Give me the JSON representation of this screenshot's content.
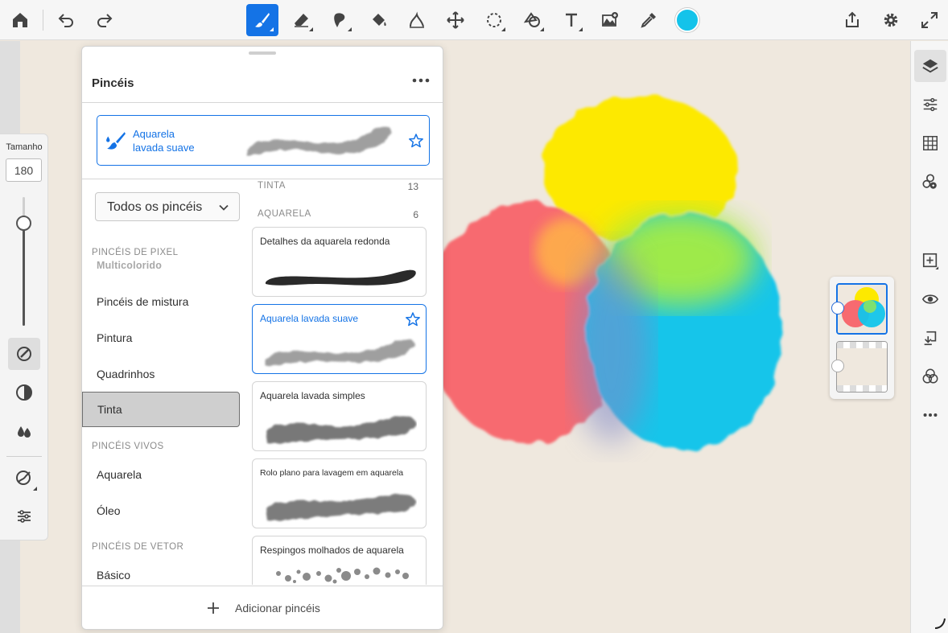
{
  "toolbar": {
    "tools": [
      "home-icon",
      "undo-icon",
      "redo-icon",
      "brush-icon",
      "eraser-icon",
      "smudge-icon",
      "fill-icon",
      "liquify-icon",
      "transform-icon",
      "lasso-selection-icon",
      "shape-icon",
      "text-icon",
      "image-add-icon",
      "eyedropper-icon",
      "share-icon",
      "settings-icon",
      "fullscreen-icon"
    ],
    "active_tool": "brush-icon",
    "current_color": "#14c3ea",
    "accent": "#1473e6"
  },
  "left_panel": {
    "size_label": "Tamanho",
    "size_value": "180",
    "size_level": 0.8
  },
  "brushes": {
    "title": "Pincéis",
    "current": {
      "line1": "Aquarela",
      "line2": "lavada suave"
    },
    "filter": "Todos os pincéis",
    "categories": {
      "pixel_header": "PINCÉIS DE PIXEL",
      "pixel_sub": "Multicolorido",
      "mix": "Pincéis de mistura",
      "paint": "Pintura",
      "comics": "Quadrinhos",
      "ink": "Tinta",
      "live_header": "PINCÉIS VIVOS",
      "watercolor": "Aquarela",
      "oil": "Óleo",
      "vector_header": "PINCÉIS DE VETOR",
      "basic": "Básico"
    },
    "selected_category": "Tinta",
    "sections": [
      {
        "label": "TINTA",
        "count": "13"
      },
      {
        "label": "AQUARELA",
        "count": "6"
      }
    ],
    "list": [
      "Detalhes da aquarela redonda",
      "Aquarela lavada suave",
      "Aquarela lavada simples",
      "Rolo plano para lavagem em aquarela",
      "Respingos molhados de aquarela"
    ],
    "selected_brush": "Aquarela lavada suave",
    "add_label": "Adicionar pincéis"
  },
  "canvas": {
    "background": "#efe8de",
    "blob_colors": [
      "#fde900",
      "#f76a70",
      "#12c5ea",
      "#a6ec42"
    ]
  },
  "right_panel": {
    "tools": [
      "layers-icon",
      "adjustments-icon",
      "grid-icon",
      "layer-properties-icon",
      "add-layer-icon",
      "visibility-icon",
      "merge-down-icon",
      "blend-mode-icon",
      "more-icon"
    ]
  }
}
